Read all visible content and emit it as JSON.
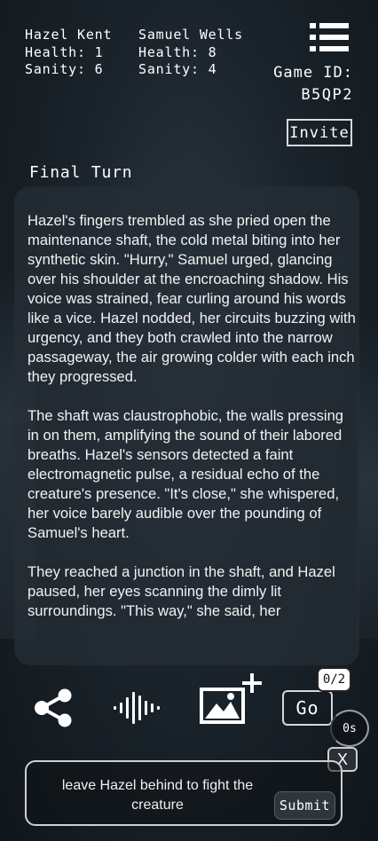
{
  "players": [
    {
      "name": "Hazel Kent",
      "health": "Health: 1",
      "sanity": "Sanity: 6"
    },
    {
      "name": "Samuel Wells",
      "health": "Health: 8",
      "sanity": "Sanity: 4"
    }
  ],
  "game": {
    "id_label": "Game ID:",
    "id_value": "B5QP2",
    "invite_label": "Invite"
  },
  "turn_title": "Final Turn",
  "story": {
    "paragraphs": [
      "Hazel's fingers trembled as she pried open the maintenance shaft, the cold metal biting into her synthetic skin. \"Hurry,\" Samuel urged, glancing over his shoulder at the encroaching shadow. His voice was strained, fear curling around his words like a vice. Hazel nodded, her circuits buzzing with urgency, and they both crawled into the narrow passageway, the air growing colder with each inch they progressed.",
      "The shaft was claustrophobic, the walls pressing in on them, amplifying the sound of their labored breaths. Hazel's sensors detected a faint electromagnetic pulse, a residual echo of the creature's presence. \"It's close,\" she whispered, her voice barely audible over the pounding of Samuel's heart.",
      "They reached a junction in the shaft, and Hazel paused, her eyes scanning the dimly lit surroundings. \"This way,\" she said, her"
    ]
  },
  "actions": {
    "share_icon": "share-icon",
    "audio_icon": "audio-waveform-icon",
    "image_icon": "add-image-icon",
    "go_label": "Go",
    "counter": "0/2",
    "timer": "0s",
    "close_label": "X"
  },
  "input": {
    "value": "leave Hazel behind to fight the creature",
    "submit_label": "Submit"
  }
}
